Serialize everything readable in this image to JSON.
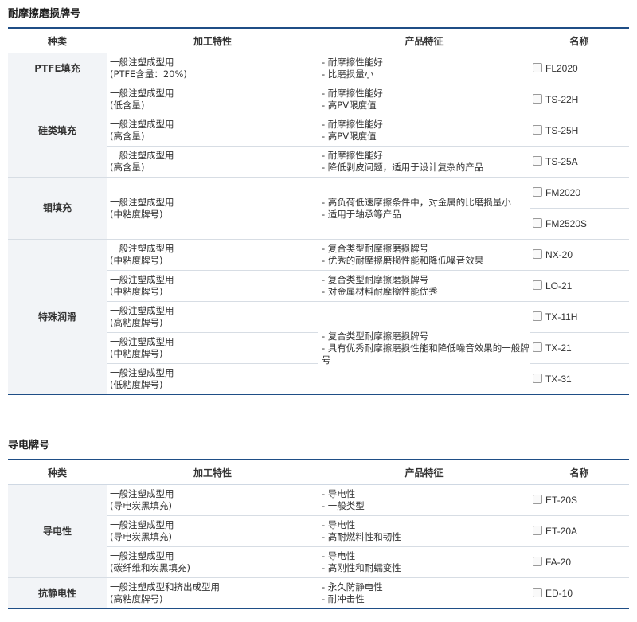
{
  "headers": [
    "种类",
    "加工特性",
    "产品特征",
    "名称"
  ],
  "section1": {
    "title": "耐摩擦磨损牌号",
    "groups": [
      {
        "kind": "PTFE填充",
        "rows": [
          {
            "proc": [
              "一般注塑成型用",
              "(PTFE含量：20%)"
            ],
            "feat": [
              "- 耐摩擦性能好",
              "- 比磨损量小"
            ],
            "name": "FL2020"
          }
        ]
      },
      {
        "kind": "硅类填充",
        "rows": [
          {
            "proc": [
              "一般注塑成型用",
              "(低含量)"
            ],
            "feat": [
              "- 耐摩擦性能好",
              "- 高PV限度值"
            ],
            "name": "TS-22H"
          },
          {
            "proc": [
              "一般注塑成型用",
              "(高含量)"
            ],
            "feat": [
              "- 耐摩擦性能好",
              "- 高PV限度值"
            ],
            "name": "TS-25H"
          },
          {
            "proc": [
              "一般注塑成型用",
              "(高含量)"
            ],
            "feat": [
              "- 耐摩擦性能好",
              "- 降低剥皮问题，适用于设计复杂的产品"
            ],
            "name": "TS-25A"
          }
        ]
      },
      {
        "kind": "钼填充",
        "proc": [
          "一般注塑成型用",
          "(中粘度牌号)"
        ],
        "feat": [
          "- 高负荷低速摩擦条件中，对金属的比磨损量小",
          "- 适用于轴承等产品"
        ],
        "names": [
          "FM2020",
          "FM2520S"
        ]
      },
      {
        "kind": "特殊润滑",
        "rows": [
          {
            "proc": [
              "一般注塑成型用",
              "(中粘度牌号)"
            ],
            "feat": [
              "- 复合类型耐摩擦磨损牌号",
              "- 优秀的耐摩擦磨损性能和降低噪音效果"
            ],
            "name": "NX-20"
          },
          {
            "proc": [
              "一般注塑成型用",
              "(中粘度牌号)"
            ],
            "feat": [
              "- 复合类型耐摩擦磨损牌号",
              "- 对金属材料耐摩擦性能优秀"
            ],
            "name": "LO-21"
          }
        ],
        "shared_feat": [
          "- 复合类型耐摩擦磨损牌号",
          "- 具有优秀耐摩擦磨损性能和降低噪音效果的一般牌号"
        ],
        "shared_rows": [
          {
            "proc": [
              "一般注塑成型用",
              "(高粘度牌号)"
            ],
            "name": "TX-11H"
          },
          {
            "proc": [
              "一般注塑成型用",
              "(中粘度牌号)"
            ],
            "name": "TX-21"
          },
          {
            "proc": [
              "一般注塑成型用",
              "(低粘度牌号)"
            ],
            "name": "TX-31"
          }
        ]
      }
    ]
  },
  "section2": {
    "title": "导电牌号",
    "groups": [
      {
        "kind": "导电性",
        "rows": [
          {
            "proc": [
              "一般注塑成型用",
              "(导电炭黑填充)"
            ],
            "feat": [
              "- 导电性",
              "- 一般类型"
            ],
            "name": "ET-20S"
          },
          {
            "proc": [
              "一般注塑成型用",
              "(导电炭黑填充)"
            ],
            "feat": [
              "- 导电性",
              "- 高耐燃料性和韧性"
            ],
            "name": "ET-20A"
          },
          {
            "proc": [
              "一般注塑成型用",
              "(碳纤维和炭黑填充)"
            ],
            "feat": [
              "- 导电性",
              "- 高刚性和耐蠕变性"
            ],
            "name": "FA-20"
          }
        ]
      },
      {
        "kind": "抗静电性",
        "rows": [
          {
            "proc": [
              "一般注塑成型和挤出成型用",
              "(高粘度牌号)"
            ],
            "feat": [
              "- 永久防静电性",
              "- 耐冲击性"
            ],
            "name": "ED-10"
          }
        ]
      }
    ]
  }
}
